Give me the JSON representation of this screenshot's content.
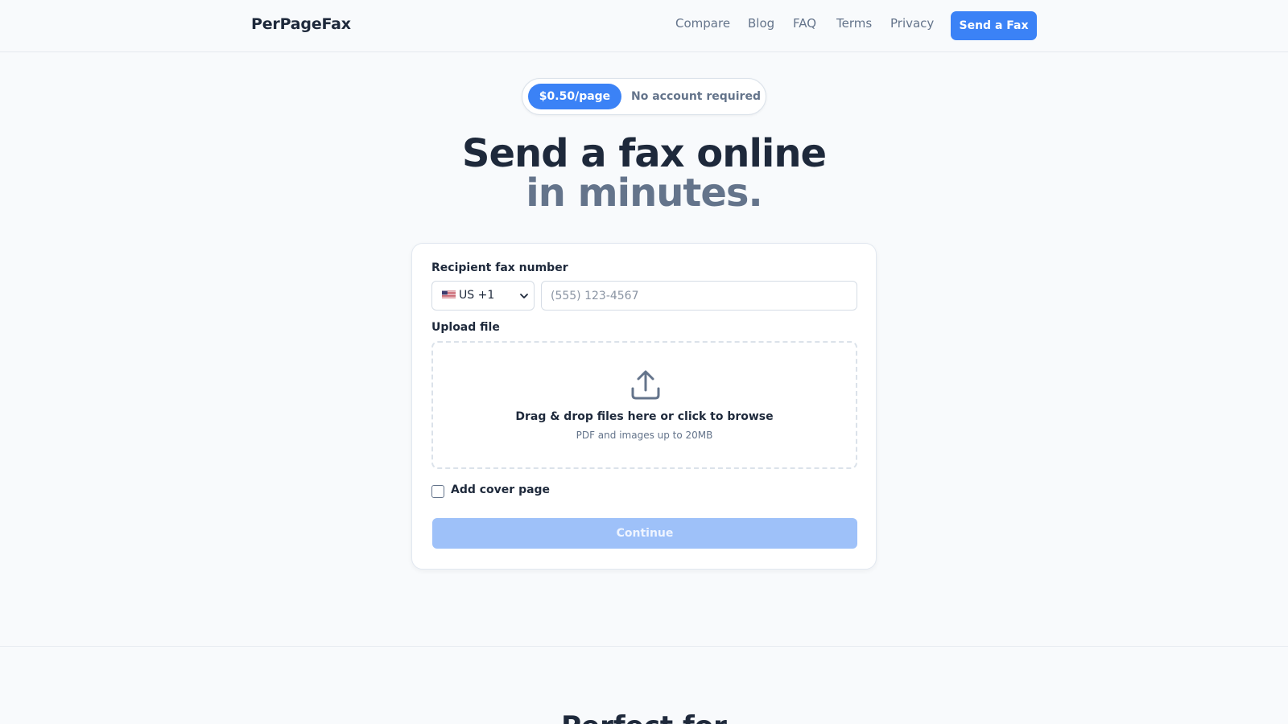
{
  "header": {
    "logo": "PerPageFax",
    "nav": [
      "Compare",
      "Blog",
      "FAQ",
      "Terms",
      "Privacy"
    ],
    "cta": "Send a Fax"
  },
  "pill": {
    "price": "$0.50/page",
    "note": "No account required"
  },
  "hero": {
    "line1": "Send a fax online",
    "line2": "in minutes."
  },
  "form": {
    "recipient_label": "Recipient fax number",
    "country_select": "US +1",
    "country_flag_icon": "us-flag-icon",
    "phone_placeholder": "(555) 123-4567",
    "upload_label": "Upload file",
    "dropzone_icon": "upload-icon",
    "dropzone_text": "Drag & drop files here or click to browse",
    "dropzone_hint": "PDF and images up to 20MB",
    "cover_page_label": "Add cover page",
    "cover_page_checked": false,
    "continue_label": "Continue"
  },
  "section2": {
    "title": "Perfect for"
  },
  "colors": {
    "accent": "#3b82f6",
    "text": "#1e293b",
    "muted": "#64748b",
    "background": "#f8fafc",
    "disabled_button": "#9ec1f9"
  }
}
